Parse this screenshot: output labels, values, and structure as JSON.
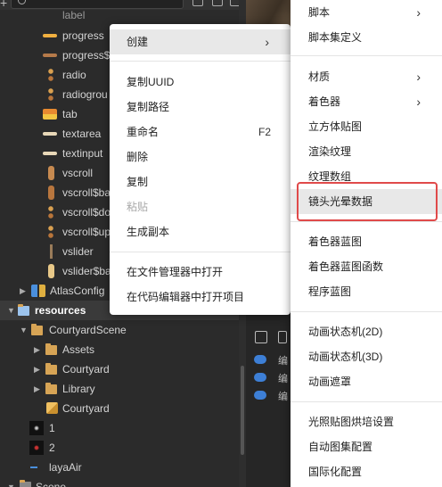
{
  "tree": {
    "items": [
      {
        "label": "label",
        "icon": "label-skin-icon"
      },
      {
        "label": "progress",
        "icon": "progress-skin-icon"
      },
      {
        "label": "progress$",
        "icon": "progress-bar-skin-icon"
      },
      {
        "label": "radio",
        "icon": "radio-skin-icon"
      },
      {
        "label": "radiogrou",
        "icon": "radiogroup-skin-icon"
      },
      {
        "label": "tab",
        "icon": "tab-skin-icon"
      },
      {
        "label": "textarea",
        "icon": "textarea-skin-icon"
      },
      {
        "label": "textinput",
        "icon": "textinput-skin-icon"
      },
      {
        "label": "vscroll",
        "icon": "vscroll-skin-icon"
      },
      {
        "label": "vscroll$ba",
        "icon": "vscroll-bar-skin-icon"
      },
      {
        "label": "vscroll$do",
        "icon": "vscroll-down-skin-icon"
      },
      {
        "label": "vscroll$up",
        "icon": "vscroll-up-skin-icon"
      },
      {
        "label": "vslider",
        "icon": "vslider-skin-icon"
      },
      {
        "label": "vslider$ba",
        "icon": "vslider-bar-skin-icon"
      },
      {
        "label": "AtlasConfig",
        "icon": "atlas-config-icon"
      },
      {
        "label": "resources",
        "icon": "folder-icon"
      },
      {
        "label": "CourtyardScene",
        "icon": "folder-icon"
      },
      {
        "label": "Assets",
        "icon": "folder-icon"
      },
      {
        "label": "Courtyard",
        "icon": "folder-icon"
      },
      {
        "label": "Library",
        "icon": "folder-icon"
      },
      {
        "label": "Courtyard",
        "icon": "scene-cube-icon"
      },
      {
        "label": "1",
        "icon": "image-thumbnail-icon"
      },
      {
        "label": "2",
        "icon": "image-thumbnail-icon"
      },
      {
        "label": "layaAir",
        "icon": "image-thumbnail-icon"
      },
      {
        "label": "Scene",
        "icon": "scene-icon"
      }
    ]
  },
  "context_menu": {
    "items": [
      {
        "label": "创建",
        "has_submenu": true
      },
      {
        "label": "复制UUID"
      },
      {
        "label": "复制路径"
      },
      {
        "label": "重命名",
        "shortcut": "F2"
      },
      {
        "label": "删除"
      },
      {
        "label": "复制"
      },
      {
        "label": "粘贴",
        "disabled": true
      },
      {
        "label": "生成副本"
      },
      {
        "label": "在文件管理器中打开"
      },
      {
        "label": "在代码编辑器中打开项目"
      }
    ]
  },
  "submenu": {
    "items": [
      {
        "label": "脚本",
        "has_submenu": true
      },
      {
        "label": "脚本集定义"
      },
      {
        "label": "材质",
        "has_submenu": true
      },
      {
        "label": "着色器",
        "has_submenu": true
      },
      {
        "label": "立方体贴图"
      },
      {
        "label": "渲染纹理"
      },
      {
        "label": "纹理数组"
      },
      {
        "label": "镜头光晕数据"
      },
      {
        "label": "着色器蓝图"
      },
      {
        "label": "着色器蓝图函数"
      },
      {
        "label": "程序蓝图"
      },
      {
        "label": "动画状态机(2D)"
      },
      {
        "label": "动画状态机(3D)"
      },
      {
        "label": "动画遮罩"
      },
      {
        "label": "光照贴图烘培设置"
      },
      {
        "label": "自动图集配置"
      },
      {
        "label": "国际化配置"
      }
    ]
  },
  "mid": {
    "label_a": "编",
    "label_b": "编",
    "label_c": "编"
  },
  "colors": {
    "highlight_border": "#e04a4a",
    "menu_bg": "#ffffff",
    "tree_bg": "#2b2b2b"
  }
}
